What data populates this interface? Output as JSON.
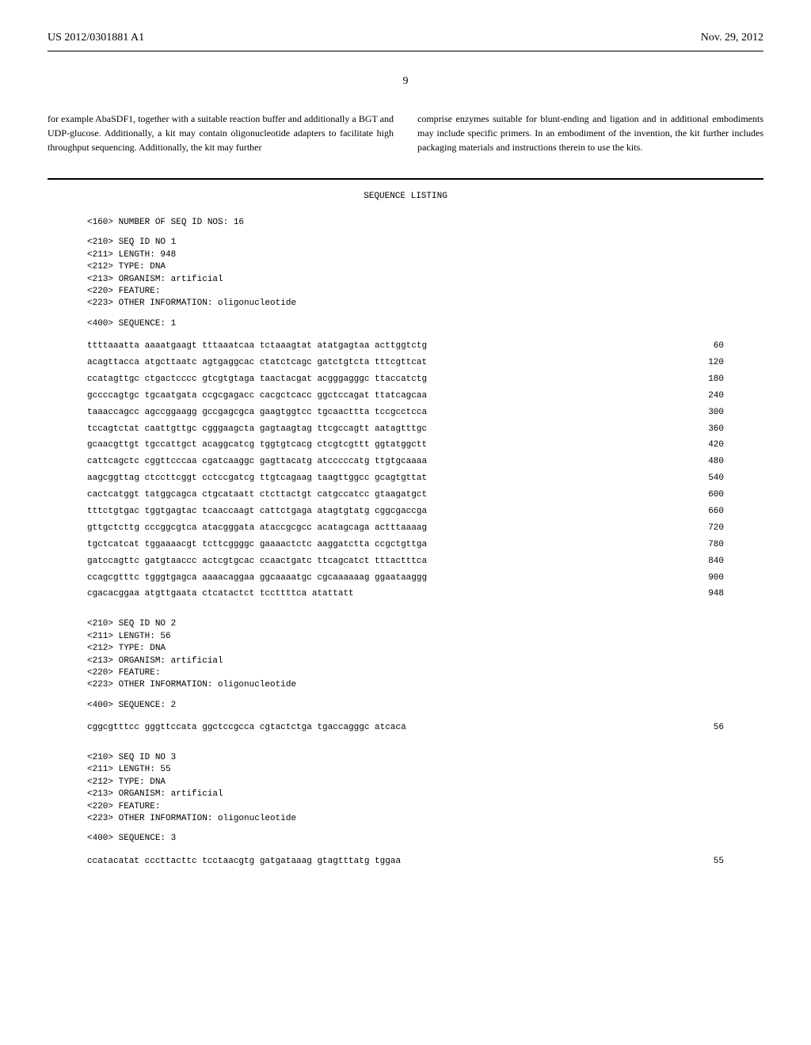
{
  "header": {
    "left": "US 2012/0301881 A1",
    "right": "Nov. 29, 2012"
  },
  "page_number": "9",
  "intro": {
    "col1": "for example AbaSDF1, together with a suitable reaction buffer and additionally a BGT and UDP-glucose. Additionally, a kit may contain oligonucleotide adapters to facilitate high throughput sequencing. Additionally, the kit may further",
    "col2": "comprise enzymes suitable for blunt-ending and ligation and in additional embodiments may include specific primers. In an embodiment of the invention, the kit further includes packaging materials and instructions therein to use the kits."
  },
  "sequence_listing": {
    "title": "SEQUENCE LISTING",
    "header_line": "<160> NUMBER OF SEQ ID NOS: 16",
    "sequences": [
      {
        "meta": [
          "<210> SEQ ID NO 1",
          "<211> LENGTH: 948",
          "<212> TYPE: DNA",
          "<213> ORGANISM: artificial",
          "<220> FEATURE:",
          "<223> OTHER INFORMATION: oligonucleotide"
        ],
        "sequence_label": "<400> SEQUENCE: 1",
        "rows": [
          {
            "groups": "ttttaaatta aaaatgaagt tttaaatcaa tctaaagtat atatgagtaa acttggtctg",
            "num": "60"
          },
          {
            "groups": "acagttacca atgcttaatc agtgaggcac ctatctcagc gatctgtcta tttcgttcat",
            "num": "120"
          },
          {
            "groups": "ccatagttgc ctgactcccc gtcgtgtaga taactacgat acgggagggc ttaccatctg",
            "num": "180"
          },
          {
            "groups": "gccccagtgc tgcaatgata ccgcgagacc cacgctcacc ggctccagat ttatcagcaa",
            "num": "240"
          },
          {
            "groups": "taaaccagcc agccggaagg gccgagcgca gaagtggtcc tgcaacttta tccgcctcca",
            "num": "300"
          },
          {
            "groups": "tccagtctat caattgttgc cgggaagcta gagtaagtag ttcgccagtt aatagtttgc",
            "num": "360"
          },
          {
            "groups": "gcaacgttgt tgccattgct acaggcatcg tggtgtcacg ctcgtcgttt ggtatggctt",
            "num": "420"
          },
          {
            "groups": "cattcagctc cggttcccaa cgatcaaggc gagttacatg atcccccatg ttgtgcaaaa",
            "num": "480"
          },
          {
            "groups": "aagcggttag ctccttcggt cctccgatcg ttgtcagaag taagttggcc gcagtgttat",
            "num": "540"
          },
          {
            "groups": "cactcatggt tatggcagca ctgcataatt ctcttactgt catgccatcc gtaagatgct",
            "num": "600"
          },
          {
            "groups": "tttctgtgac tggtgagtac tcaaccaagt cattctgaga atagtgtatg cggcgaccga",
            "num": "660"
          },
          {
            "groups": "gttgctcttg cccggcgtca atacgggata ataccgcgcc acatagcaga actttaaaag",
            "num": "720"
          },
          {
            "groups": "tgctcatcat tggaaaacgt tcttcggggc gaaaactctc aaggatctta ccgctgttga",
            "num": "780"
          },
          {
            "groups": "gatccagttc gatgtaaccc actcgtgcac ccaactgatc ttcagcatct tttactttca",
            "num": "840"
          },
          {
            "groups": "ccagcgtttc tgggtgagca aaaacaggaa ggcaaaatgc cgcaaaaaag ggaataaggg",
            "num": "900"
          },
          {
            "groups": "cgacacggaa atgttgaata ctcatactct tccttttca atattatt",
            "num": "948"
          }
        ]
      },
      {
        "meta": [
          "<210> SEQ ID NO 2",
          "<211> LENGTH: 56",
          "<212> TYPE: DNA",
          "<213> ORGANISM: artificial",
          "<220> FEATURE:",
          "<223> OTHER INFORMATION: oligonucleotide"
        ],
        "sequence_label": "<400> SEQUENCE: 2",
        "rows": [
          {
            "groups": "cggcgtttcc gggttccata ggctccgcca cgtactctga tgaccagggc atcaca",
            "num": "56"
          }
        ]
      },
      {
        "meta": [
          "<210> SEQ ID NO 3",
          "<211> LENGTH: 55",
          "<212> TYPE: DNA",
          "<213> ORGANISM: artificial",
          "<220> FEATURE:",
          "<223> OTHER INFORMATION: oligonucleotide"
        ],
        "sequence_label": "<400> SEQUENCE: 3",
        "rows": [
          {
            "groups": "ccatacatat cccttacttc tcctaacgtg gatgataaag gtagtttatg tggaa",
            "num": "55"
          }
        ]
      }
    ]
  }
}
